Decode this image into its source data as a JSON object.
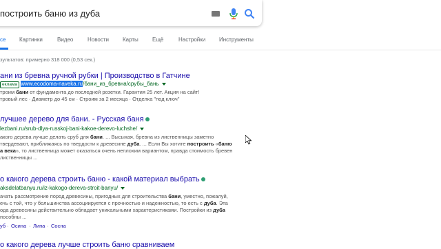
{
  "search": {
    "query": "построить баню из дуба"
  },
  "tabs": [
    "се",
    "Картинки",
    "Видео",
    "Новости",
    "Карты",
    "Ещё",
    "Настройки",
    "Инструменты"
  ],
  "stats": "зультатов: примерно 318 000 (0,53 сек.)",
  "results": [
    {
      "title": "ани из бревна ручной рубки | Производство в Гатчине",
      "ad_label": "еклама",
      "url": "www.ecodoma-naveka.ru",
      "url_rest": "/бани_из_бревна/срубы_бань",
      "snippet": [
        [
          "троим ",
          "бани",
          " от фундамента до последней розетки. Гарантия 25 лет. Акция на сайт!"
        ],
        [
          "тровый лес · Диаметр до 45 см · Строим за 2 месяца · Отделка \"под ключ\""
        ]
      ]
    },
    {
      "title": "лучшее дерево для бани. - Русская баня",
      "url": "lezbani.ru/srub-dlya-russkoj-bani-kakoe-derevo-luchshe/",
      "snippet": [
        [
          "акого дерева лучше делать сруб для ",
          "бани",
          ". ... Высыхая, бревна из лиственницы заметно"
        ],
        [
          "твердевают, приближаясь по твердости к древесине ",
          "дуба",
          ". ... Если Вы хотите ",
          "построить",
          " «",
          "баню"
        ],
        [
          "а века",
          "», то лиственница может оказаться очень неплохим вариантом, правда стоимость бревен"
        ],
        [
          "лиственницы ..."
        ]
      ]
    },
    {
      "title": "о какого дерева строить баню - какой материал выбрать",
      "url": "aksdelatbanyu.ru/iz-kakogo-dereva-stroit-banyu/",
      "snippet": [
        [
          "ачать рассмотрение пород древесины, пригодных для строительства ",
          "бани",
          ", уместно, пожалуй,"
        ],
        [
          "ечь с той, что у большинства ассоциируется с прочностью и надежностью, то есть с ",
          "дуба",
          ". Эта"
        ],
        [
          "ода древесины действительно обладает уникальными характеристиками. Постройки из ",
          "дуба"
        ],
        [
          "пособны ..."
        ]
      ],
      "sitelinks": [
        "уб",
        "Осина",
        "Липа",
        "Сосна"
      ]
    },
    {
      "title": "о какого дерева лучше строить баню сравниваем"
    }
  ]
}
